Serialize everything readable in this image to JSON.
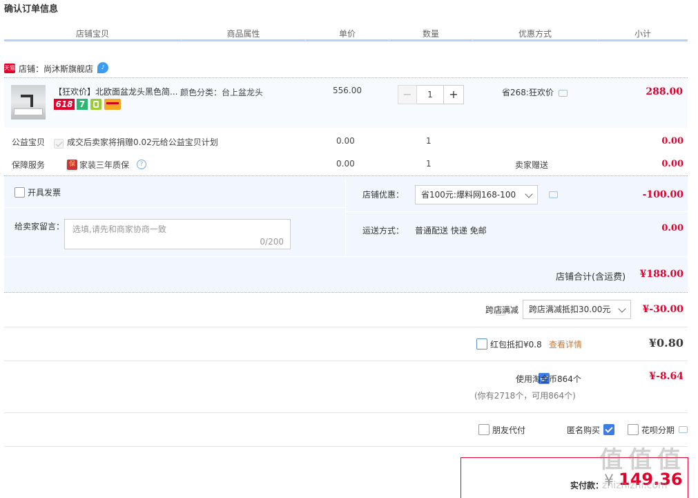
{
  "page_title": "确认订单信息",
  "columns": [
    "店铺宝贝",
    "商品属性",
    "单价",
    "数量",
    "优惠方式",
    "小计"
  ],
  "shop": {
    "badge": "天猫",
    "label": "店铺：",
    "name": "尚沐斯旗舰店"
  },
  "item": {
    "title": "【狂欢价】北欧面盆龙头黑色简...",
    "attr": "颜色分类：台上盆龙头",
    "price": "556.00",
    "qty": "1",
    "minus": "−",
    "plus": "+",
    "promo": "省268:狂欢价",
    "subtotal": "288.00",
    "badges": [
      "618",
      "7"
    ]
  },
  "charity": {
    "label": "公益宝贝",
    "desc": "成交后卖家将捐赠0.02元给公益宝贝计划",
    "price": "0.00",
    "qty": "1",
    "subtotal": "0.00"
  },
  "warranty": {
    "label": "保障服务",
    "badge": "保",
    "desc": "家装三年质保",
    "price": "0.00",
    "qty": "1",
    "promo": "卖家赠送",
    "subtotal": "0.00"
  },
  "invoice": {
    "label": "开具发票"
  },
  "message": {
    "label": "给卖家留言：",
    "placeholder": "选填,请先和商家协商一致",
    "counter": "0/200"
  },
  "shop_discount": {
    "label": "店铺优惠：",
    "selected": "省100元:爆料网168-100",
    "amount": "-100.00"
  },
  "shipping": {
    "label": "运送方式：",
    "value": "普通配送 快递 免邮",
    "amount": "0.00"
  },
  "shop_total": {
    "label": "店铺合计(含运费)",
    "amount": "¥188.00"
  },
  "cross_store": {
    "label": "跨店满减",
    "selected": "跨店满减抵扣30.00元",
    "amount": "¥-30.00"
  },
  "red_packet": {
    "label": "红包抵扣¥0.8",
    "link": "查看详情",
    "amount": "¥0.80"
  },
  "taojinbi": {
    "label": "使用淘金币864个",
    "note": "(你有2718个，可用864个)",
    "amount": "¥-8.64"
  },
  "options": {
    "friend_pay": "朋友代付",
    "anonymous": "匿名购买",
    "huabei": "花呗分期"
  },
  "final": {
    "label": "实付款：",
    "currency": "¥",
    "amount": "149.36"
  },
  "watermark": {
    "text": "值 值 值",
    "url": "zhizhizhi.com"
  },
  "colors": {
    "price_red": "#e4002b",
    "panel_bg": "#f2f7ff",
    "item_bg": "#f7fbff",
    "accent_blue": "#3c7ce6"
  }
}
